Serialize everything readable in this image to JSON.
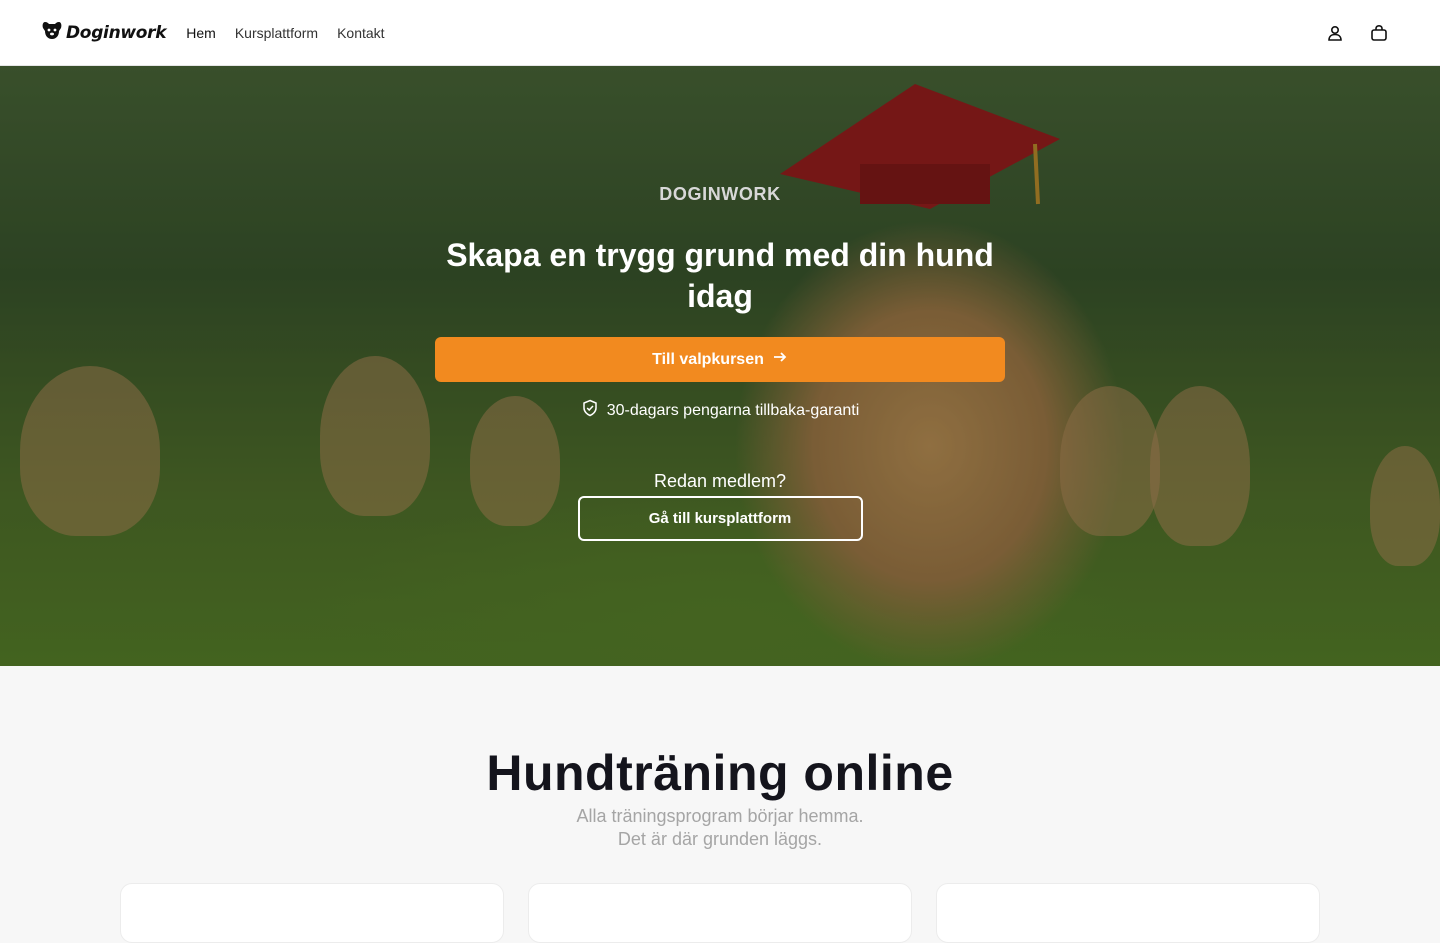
{
  "header": {
    "logo_text": "Doginwork",
    "nav": [
      {
        "label": "Hem"
      },
      {
        "label": "Kursplattform"
      },
      {
        "label": "Kontakt"
      }
    ],
    "icons": [
      "user-icon",
      "shopping-bag-icon"
    ]
  },
  "hero": {
    "eyebrow": "DOGINWORK",
    "title": "Skapa en trygg grund med din hund idag",
    "cta_label": "Till valpkursen",
    "guarantee": "30-dagars pengarna tillbaka-garanti",
    "member_question": "Redan medlem?",
    "platform_button": "Gå till kursplattform",
    "accent_color": "#f28a1f"
  },
  "section": {
    "title": "Hundträning online",
    "subtitle_line1": "Alla träningsprogram börjar hemma.",
    "subtitle_line2": "Det är där grunden läggs."
  }
}
